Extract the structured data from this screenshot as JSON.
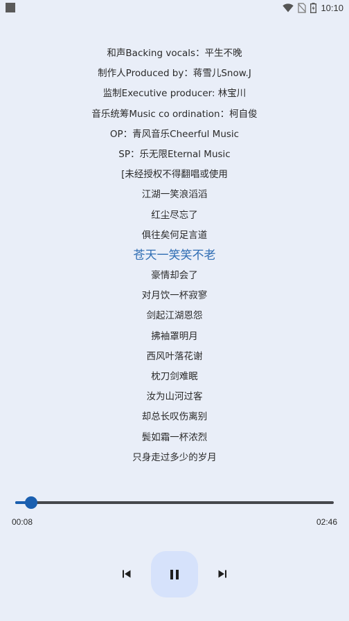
{
  "status_bar": {
    "time": "10:10",
    "icons": [
      "notification-square-icon",
      "wifi-icon",
      "no-sim-icon",
      "battery-icon"
    ]
  },
  "lyrics": {
    "current_index": 10,
    "lines": [
      "和声Backing vocals：平生不晚",
      "制作人Produced by：蒋雪儿Snow.J",
      "监制Executive producer: 林宝川",
      "音乐统筹Music co ordination：柯自俊",
      "OP：青风音乐Cheerful Music",
      "SP：乐无限Eternal Music",
      "[未经授权不得翻唱或使用",
      "江湖一笑浪滔滔",
      "红尘尽忘了",
      "俱往矣何足言道",
      "苍天一笑笑不老",
      "豪情却会了",
      "对月饮一杯寂寥",
      "剑起江湖恩怨",
      "拂袖罩明月",
      "西风叶落花谢",
      "枕刀剑难眠",
      "汝为山河过客",
      "却总长叹伤离别",
      "鬓如霜一杯浓烈",
      "只身走过多少的岁月"
    ]
  },
  "player": {
    "elapsed": "00:08",
    "total": "02:46",
    "progress_fraction": 0.05,
    "accent_color": "#1a5fb0",
    "current_lyric_color": "#2f6db3",
    "play_button_bg": "#d6e2fb",
    "state": "playing"
  },
  "controls": {
    "prev_icon": "skip-previous-icon",
    "pause_icon": "pause-icon",
    "next_icon": "skip-next-icon"
  }
}
